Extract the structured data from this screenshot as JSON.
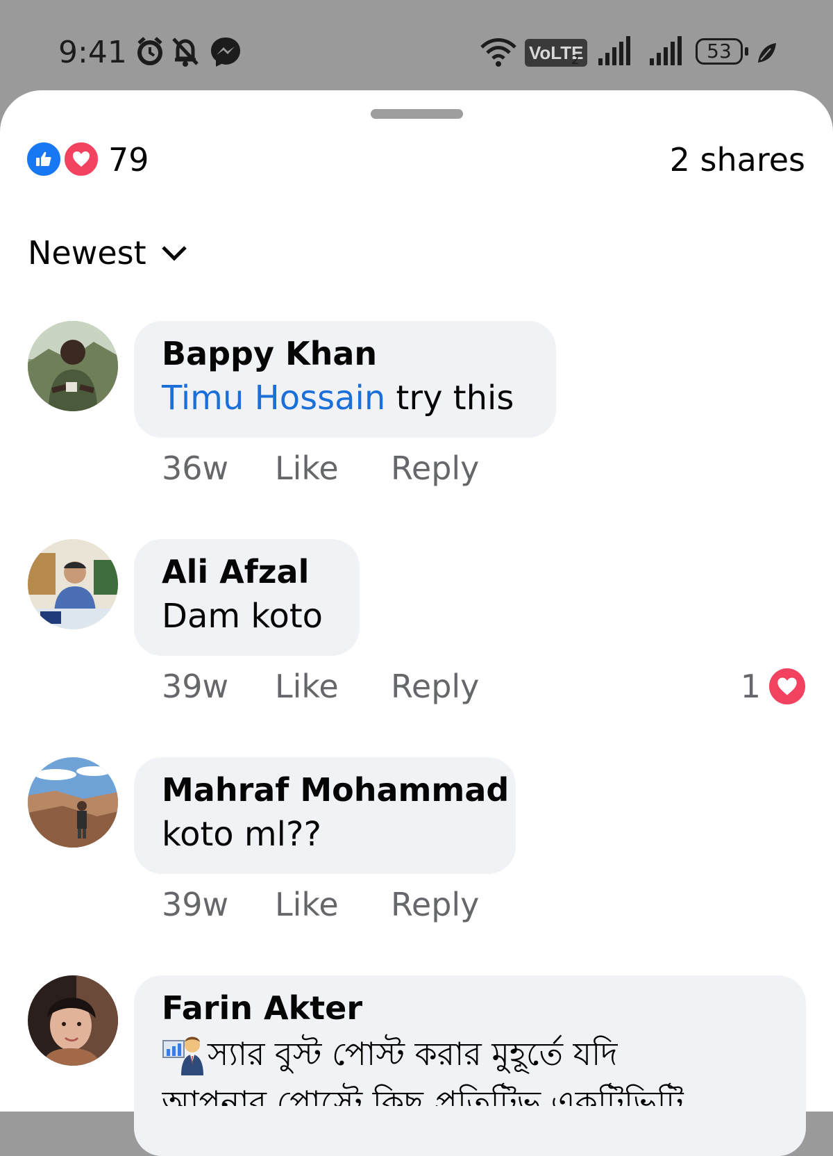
{
  "status_bar": {
    "time": "9:41",
    "network_label": "VoLTE",
    "network_sub": "2",
    "battery": "53",
    "icons": [
      "alarm-icon",
      "mute-bell-icon",
      "messenger-icon",
      "wifi-icon",
      "signal-icon",
      "signal-icon",
      "leaf-icon"
    ]
  },
  "colors": {
    "like_blue": "#1877f2",
    "love_red": "#f3425f",
    "mention_blue": "#1b6fd9",
    "bubble": "#f0f2f5",
    "meta_gray": "#65676b"
  },
  "post": {
    "reaction_count": "79",
    "shares": "2 shares",
    "sort_label": "Newest"
  },
  "comments": [
    {
      "author": "Bappy Khan",
      "mention": "Timu Hossain",
      "text": " try this",
      "time": "36w",
      "like": "Like",
      "reply": "Reply"
    },
    {
      "author": "Ali Afzal",
      "text": "Dam koto",
      "time": "39w",
      "like": "Like",
      "reply": "Reply",
      "reaction_count": "1"
    },
    {
      "author": "Mahraf Mohammad",
      "text": "koto ml??",
      "time": "39w",
      "like": "Like",
      "reply": "Reply"
    },
    {
      "author": "Farin Akter",
      "text": "স্যার বুস্ট পোস্ট করার মুহূর্তে যদি",
      "text_line2": "আপনার পোস্টে কিছু প্রতিটিভ একটিভিটি"
    }
  ]
}
